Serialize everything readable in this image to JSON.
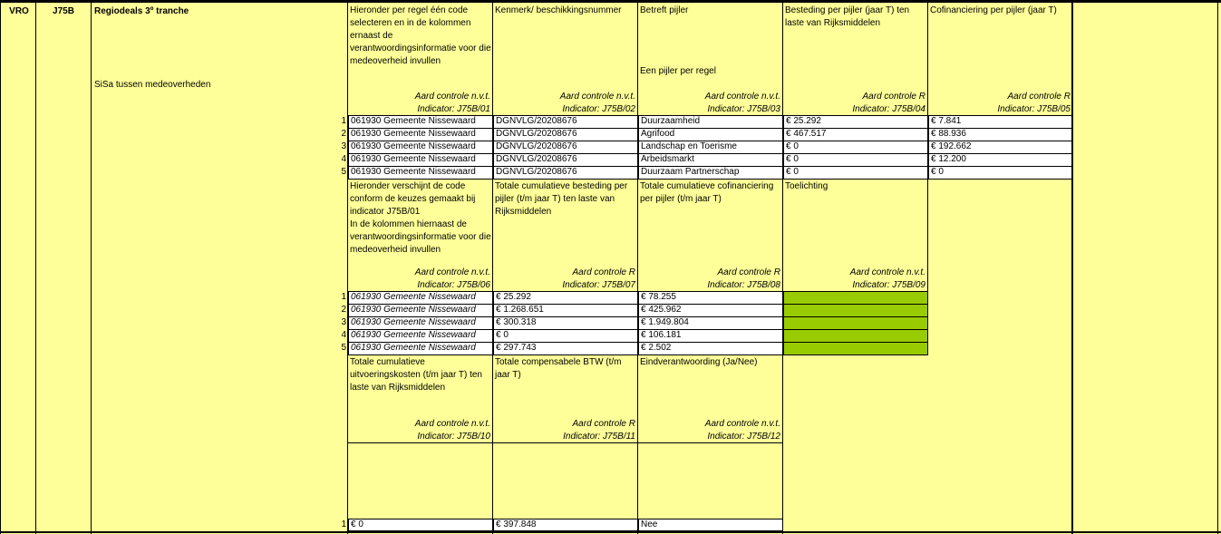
{
  "row_header": {
    "col_a": "VRO",
    "col_b": "J75B",
    "title": "Regiodeals 3º tranche",
    "subtitle": "SiSa tussen medeoverheden"
  },
  "block1": {
    "headers": [
      "Hieronder per regel één code selecteren en in de kolommen ernaast de verantwoordingsinformatie voor die medeoverheid invullen",
      "Kenmerk/ beschikkingsnummer",
      "Betreft pijler",
      "Besteding per pijler (jaar T) ten laste van Rijksmiddelen",
      "Cofinanciering per pijler (jaar T)"
    ],
    "pillar_note": "Een pijler per regel",
    "controls": [
      "Aard controle n.v.t.",
      "Aard controle n.v.t.",
      "Aard controle n.v.t.",
      "Aard controle R",
      "Aard controle R"
    ],
    "indicators": [
      "Indicator: J75B/01",
      "Indicator: J75B/02",
      "Indicator: J75B/03",
      "Indicator: J75B/04",
      "Indicator: J75B/05"
    ],
    "rows": [
      {
        "n": "1",
        "code": "061930 Gemeente Nissewaard",
        "kenmerk": "DGNVLG/20208676",
        "pijler": "Duurzaamheid",
        "besteding": "€ 25.292",
        "cofin": "€ 7.841"
      },
      {
        "n": "2",
        "code": "061930 Gemeente Nissewaard",
        "kenmerk": "DGNVLG/20208676",
        "pijler": "Agrifood",
        "besteding": "€ 467.517",
        "cofin": "€ 88.936"
      },
      {
        "n": "3",
        "code": "061930 Gemeente Nissewaard",
        "kenmerk": "DGNVLG/20208676",
        "pijler": "Landschap en Toerisme",
        "besteding": "€ 0",
        "cofin": "€ 192.662"
      },
      {
        "n": "4",
        "code": "061930 Gemeente Nissewaard",
        "kenmerk": "DGNVLG/20208676",
        "pijler": "Arbeidsmarkt",
        "besteding": "€ 0",
        "cofin": "€ 12.200"
      },
      {
        "n": "5",
        "code": "061930 Gemeente Nissewaard",
        "kenmerk": "DGNVLG/20208676",
        "pijler": "Duurzaam Partnerschap",
        "besteding": "€ 0",
        "cofin": "€ 0"
      }
    ]
  },
  "block2": {
    "headers": [
      "Hieronder verschijnt de code conform de keuzes gemaakt bij indicator J75B/01\nIn de kolommen hiernaast de verantwoordingsinformatie voor die medeoverheid invullen",
      "Totale cumulatieve besteding per pijler (t/m jaar T) ten laste van Rijksmiddelen",
      "Totale cumulatieve cofinanciering per pijler (t/m jaar T)",
      "Toelichting"
    ],
    "controls": [
      "Aard controle n.v.t.",
      "Aard controle R",
      "Aard controle R",
      "Aard controle n.v.t."
    ],
    "indicators": [
      "Indicator: J75B/06",
      "Indicator: J75B/07",
      "Indicator: J75B/08",
      "Indicator: J75B/09"
    ],
    "rows": [
      {
        "n": "1",
        "code": "061930 Gemeente Nissewaard",
        "besteding": "€ 25.292",
        "cofin": "€ 78.255"
      },
      {
        "n": "2",
        "code": "061930 Gemeente Nissewaard",
        "besteding": "€ 1.268.651",
        "cofin": "€ 425.962"
      },
      {
        "n": "3",
        "code": "061930 Gemeente Nissewaard",
        "besteding": "€ 300.318",
        "cofin": "€ 1.949.804"
      },
      {
        "n": "4",
        "code": "061930 Gemeente Nissewaard",
        "besteding": "€ 0",
        "cofin": "€ 106.181"
      },
      {
        "n": "5",
        "code": "061930 Gemeente Nissewaard",
        "besteding": "€ 297.743",
        "cofin": "€ 2.502"
      }
    ]
  },
  "block3": {
    "headers": [
      "Totale cumulatieve uitvoeringskosten (t/m jaar T) ten laste van Rijksmiddelen",
      "Totale compensabele BTW (t/m jaar T)",
      "Eindverantwoording (Ja/Nee)"
    ],
    "controls": [
      "Aard controle n.v.t.",
      "Aard controle R",
      "Aard controle n.v.t."
    ],
    "indicators": [
      "Indicator: J75B/10",
      "Indicator: J75B/11",
      "Indicator: J75B/12"
    ],
    "row": {
      "n": "1",
      "uitvoering": "€ 0",
      "btw": "€ 397.848",
      "eind": "Nee"
    }
  },
  "colors": {
    "cell_bg": "#ffff99",
    "input_bg": "#ffffff",
    "green": "#99cc00"
  }
}
